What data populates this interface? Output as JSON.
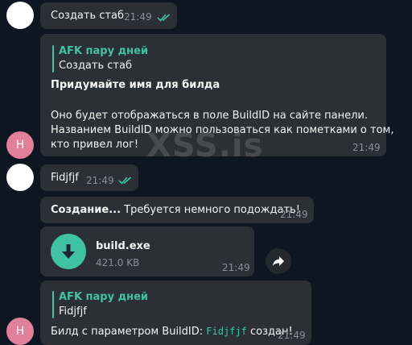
{
  "messages": [
    {
      "text": "Создать стаб",
      "time": "21:49"
    },
    {
      "quote_name": "AFK пару дней",
      "quote_text": "Создать стаб",
      "title": "Придумайте имя для билда",
      "body_line1": "Оно будет отображаться в поле BuildID на сайте панели.",
      "body_line2": "Названием BuildID можно пользоваться как пометками о том,",
      "body_line3": "кто привел лог!",
      "time": "21:49",
      "avatar_letter": "H"
    },
    {
      "text": "Fidjfjf",
      "time": "21:49"
    },
    {
      "status_bold": "Создание...",
      "status_text": " Требуется немного подождать!",
      "time": "21:49"
    },
    {
      "file_name": "build.exe",
      "file_size": "421.0 KB",
      "time": "21:49"
    },
    {
      "quote_name": "AFK пару дней",
      "quote_text": "Fidjfjf",
      "result_prefix": "Билд с параметром BuildID: ",
      "result_code": "Fidjfjf",
      "result_suffix": " создан!",
      "time": "21:49",
      "avatar_letter": "H"
    }
  ],
  "watermark": "XSS.is",
  "colors": {
    "accent": "#41c2a3",
    "bubble": "#2b2f36",
    "background": "#0e1621",
    "avatar": "#e0809a"
  },
  "icons": [
    "double-check-icon",
    "download-icon",
    "forward-icon"
  ]
}
